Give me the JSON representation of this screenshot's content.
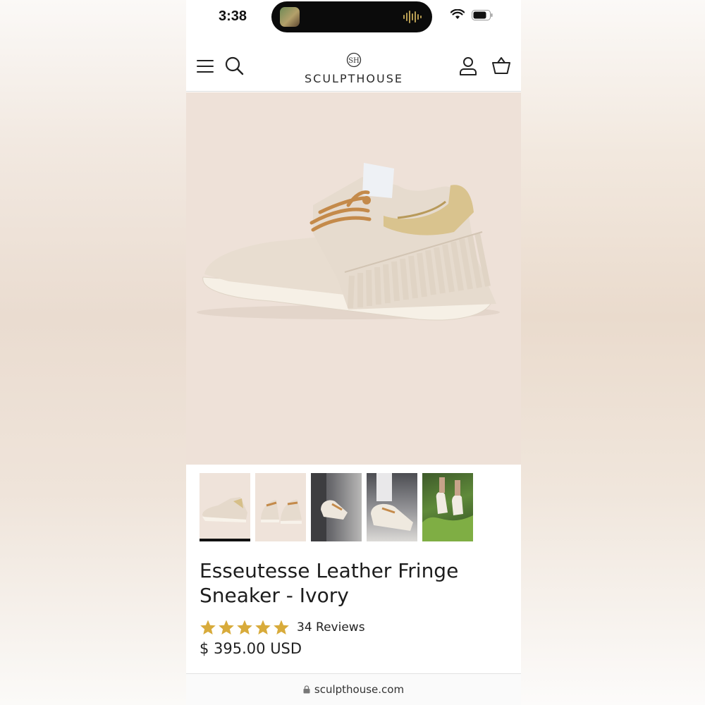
{
  "status_bar": {
    "time": "3:38"
  },
  "header": {
    "brand": "SCULPTHOUSE"
  },
  "product": {
    "title": "Esseutesse Leather Fringe Sneaker - Ivory",
    "reviews": "34 Reviews",
    "price": "$ 395.00 USD",
    "rating_stars": 5
  },
  "thumbnails": [
    {
      "name": "thumb-side-view",
      "active": true
    },
    {
      "name": "thumb-front-pair",
      "active": false
    },
    {
      "name": "thumb-lifestyle-door",
      "active": false
    },
    {
      "name": "thumb-lifestyle-feet",
      "active": false
    },
    {
      "name": "thumb-lifestyle-plants",
      "active": false
    }
  ],
  "browser": {
    "url": "sculpthouse.com"
  },
  "colors": {
    "accent_star": "#d8ab3b",
    "hero_bg": "#eee1d8"
  }
}
